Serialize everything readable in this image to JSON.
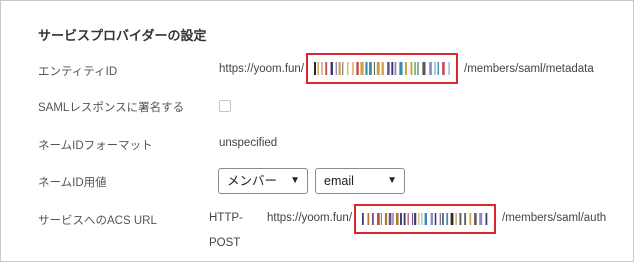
{
  "section": {
    "title": "サービスプロバイダーの設定"
  },
  "entity_id": {
    "label": "エンティティID",
    "prefix": "https://yoom.fun/",
    "suffix": "/members/saml/metadata"
  },
  "saml_sign": {
    "label": "SAMLレスポンスに署名する",
    "checked": false
  },
  "nameid_format": {
    "label": "ネームIDフォーマット",
    "value": "unspecified"
  },
  "nameid_usage": {
    "label": "ネームID用値",
    "select1_value": "メンバー",
    "select2_value": "email"
  },
  "acs_url": {
    "label": "サービスへのACS URL",
    "binding_line1": "HTTP-",
    "binding_line2": "POST",
    "prefix": "https://yoom.fun/",
    "suffix": "/members/saml/auth"
  },
  "colors": {
    "highlight": "#d8282f"
  }
}
